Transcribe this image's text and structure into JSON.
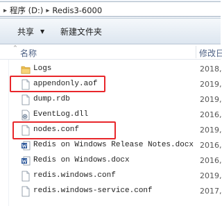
{
  "address": {
    "crumbs": [
      "程序 (D:)",
      "Redis3-6000"
    ],
    "separator": "▸"
  },
  "toolbar": {
    "share_label": "共享",
    "share_caret": "▼",
    "new_folder_label": "新建文件夹"
  },
  "columns": {
    "sort_indicator": "^",
    "name": "名称",
    "date": "修改日"
  },
  "files": [
    {
      "name": "Logs",
      "date": "2018,",
      "icon": "folder-icon"
    },
    {
      "name": "appendonly.aof",
      "date": "2019,",
      "icon": "file-icon"
    },
    {
      "name": "dump.rdb",
      "date": "2019,",
      "icon": "file-icon"
    },
    {
      "name": "EventLog.dll",
      "date": "2016,",
      "icon": "dll-icon"
    },
    {
      "name": "nodes.conf",
      "date": "2019,",
      "icon": "file-icon"
    },
    {
      "name": "Redis on Windows Release Notes.docx",
      "date": "2016,",
      "icon": "word-icon"
    },
    {
      "name": "Redis on Windows.docx",
      "date": "2016,",
      "icon": "word-icon"
    },
    {
      "name": "redis.windows.conf",
      "date": "2019,",
      "icon": "file-icon"
    },
    {
      "name": "redis.windows-service.conf",
      "date": "2017,",
      "icon": "file-icon"
    }
  ],
  "colors": {
    "highlight": "#e8262a",
    "folder": "#f1c250",
    "word": "#2b579a",
    "header_text": "#4d6185"
  }
}
